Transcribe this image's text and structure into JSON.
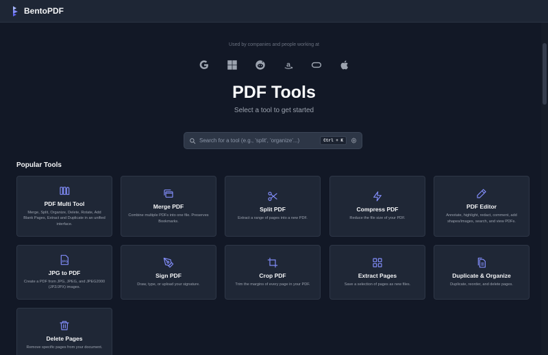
{
  "app": {
    "name": "BentoPDF"
  },
  "hero": {
    "used_by": "Used by companies and people working at",
    "title": "PDF Tools",
    "subtitle": "Select a tool to get started"
  },
  "company_logos": [
    "google-logo",
    "windows-logo",
    "reddit-logo",
    "amazon-logo",
    "capsule-logo",
    "apple-logo"
  ],
  "search": {
    "placeholder": "Search for a tool (e.g., 'split', 'organize'...)",
    "shortcut": "Ctrl + K"
  },
  "section": {
    "title": "Popular Tools"
  },
  "colors": {
    "accent": "#818cf8",
    "background": "#121826",
    "card": "#1f2736"
  },
  "tools": [
    {
      "icon": "columns-icon",
      "title": "PDF Multi Tool",
      "desc": "Merge, Split, Organize, Delete, Rotate, Add Blank Pages, Extract and Duplicate in an unified interface."
    },
    {
      "icon": "copy-icon",
      "title": "Merge PDF",
      "desc": "Combine multiple PDFs into one file. Preserves Bookmarks."
    },
    {
      "icon": "scissors-icon",
      "title": "Split PDF",
      "desc": "Extract a range of pages into a new PDF."
    },
    {
      "icon": "zap-icon",
      "title": "Compress PDF",
      "desc": "Reduce the file size of your PDF."
    },
    {
      "icon": "pencil-icon",
      "title": "PDF Editor",
      "desc": "Annotate, highlight, redact, comment, add shapes/images, search, and view PDFs."
    },
    {
      "icon": "jpg-file-icon",
      "icon_text": "JPG",
      "title": "JPG to PDF",
      "desc": "Create a PDF from JPG, JPEG, and JPEG2000 (JP2/JPX) images."
    },
    {
      "icon": "pen-tool-icon",
      "title": "Sign PDF",
      "desc": "Draw, type, or upload your signature."
    },
    {
      "icon": "crop-icon",
      "title": "Crop PDF",
      "desc": "Trim the margins of every page in your PDF."
    },
    {
      "icon": "grid-icon",
      "title": "Extract Pages",
      "desc": "Save a selection of pages as new files."
    },
    {
      "icon": "file-duplicate-icon",
      "title": "Duplicate & Organize",
      "desc": "Duplicate, reorder, and delete pages."
    },
    {
      "icon": "trash-icon",
      "title": "Delete Pages",
      "desc": "Remove specific pages from your document."
    }
  ]
}
